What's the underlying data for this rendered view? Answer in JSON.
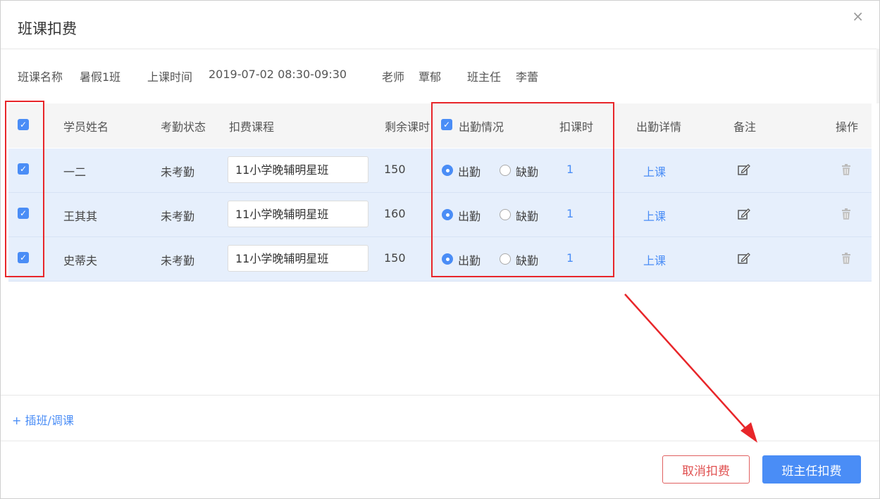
{
  "dialog": {
    "title": "班课扣费",
    "close": "×"
  },
  "info": {
    "class_label": "班课名称",
    "class_value": "暑假1班",
    "time_label": "上课时间",
    "time_value": "2019-07-02 08:30-09:30",
    "teacher_label": "老师",
    "teacher_value": "覃郁",
    "head_label": "班主任",
    "head_value": "李蕾"
  },
  "table": {
    "headers": {
      "name": "学员姓名",
      "attendance_status": "考勤状态",
      "course": "扣费课程",
      "remaining": "剩余课时",
      "attendance": "出勤情况",
      "deduct": "扣课时",
      "detail": "出勤详情",
      "remark": "备注",
      "action": "操作"
    },
    "present_label": "出勤",
    "absent_label": "缺勤",
    "rows": [
      {
        "name": "一二",
        "status": "未考勤",
        "course": "11小学晚辅明星班",
        "remaining": "150",
        "deduct": "1",
        "detail": "上课"
      },
      {
        "name": "王其其",
        "status": "未考勤",
        "course": "11小学晚辅明星班",
        "remaining": "160",
        "deduct": "1",
        "detail": "上课"
      },
      {
        "name": "史蒂夫",
        "status": "未考勤",
        "course": "11小学晚辅明星班",
        "remaining": "150",
        "deduct": "1",
        "detail": "上课"
      }
    ]
  },
  "footer": {
    "add_link": "+ 插班/调课",
    "cancel_button": "取消扣费",
    "confirm_button": "班主任扣费"
  },
  "icons": {
    "edit": "edit-icon",
    "trash": "trash-icon",
    "close": "close-icon",
    "checkbox": "checkbox-checked-icon"
  },
  "colors": {
    "accent": "#4a8df6",
    "row_bg": "#e6effc",
    "annotation": "#e8262a",
    "cancel": "#e05050"
  }
}
